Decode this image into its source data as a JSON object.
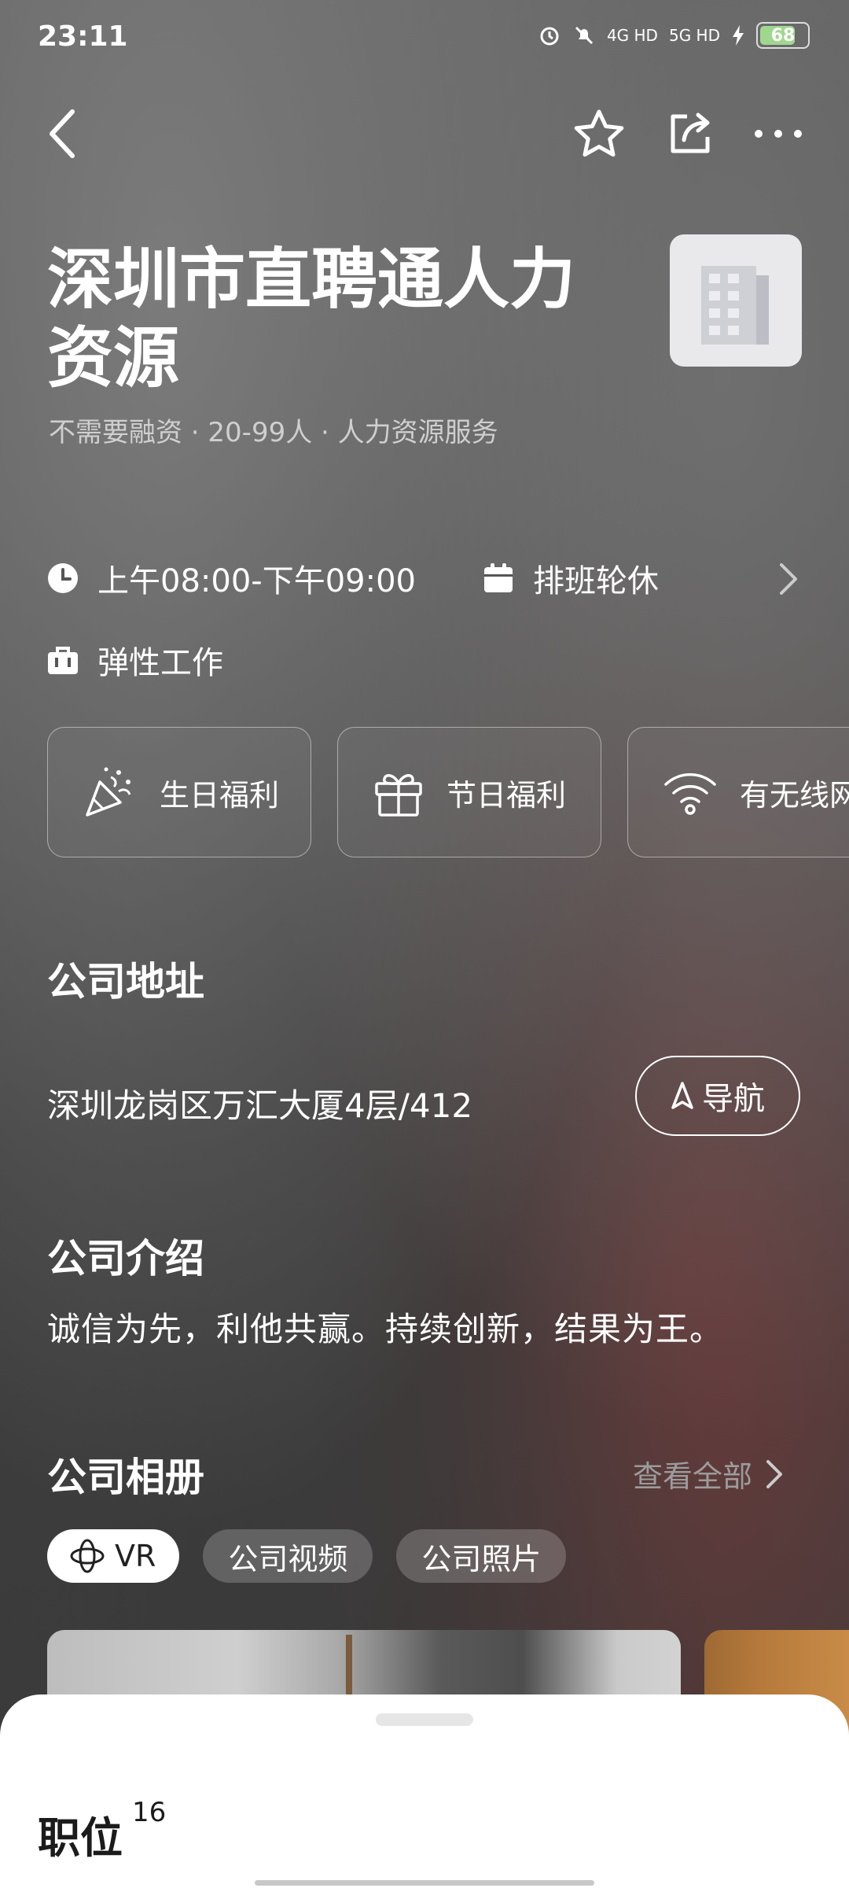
{
  "status_bar": {
    "time": "23:11",
    "network1": "4G HD",
    "network2": "5G HD",
    "battery": "68"
  },
  "company": {
    "name": "深圳市直聘通人力资源",
    "meta": "不需要融资 · 20-99人 · 人力资源服务"
  },
  "info": {
    "hours": "上午08:00-下午09:00",
    "shift": "排班轮休",
    "flexible": "弹性工作"
  },
  "benefits": [
    {
      "label": "生日福利",
      "icon": "party-popper-icon"
    },
    {
      "label": "节日福利",
      "icon": "gift-icon"
    },
    {
      "label": "有无线网",
      "icon": "wifi-icon"
    }
  ],
  "address": {
    "title": "公司地址",
    "text": "深圳龙岗区万汇大厦4层/412",
    "nav_label": "导航"
  },
  "intro": {
    "title": "公司介绍",
    "text": "诚信为先，利他共赢。持续创新，结果为王。"
  },
  "album": {
    "title": "公司相册",
    "view_all": "查看全部",
    "chips": [
      "VR",
      "公司视频",
      "公司照片"
    ]
  },
  "sheet": {
    "title": "职位",
    "count": "16"
  },
  "colors": {
    "accent_battery": "#9fd78e",
    "sheet_bg": "#ffffff",
    "muted_text": "#9c9c9c"
  }
}
